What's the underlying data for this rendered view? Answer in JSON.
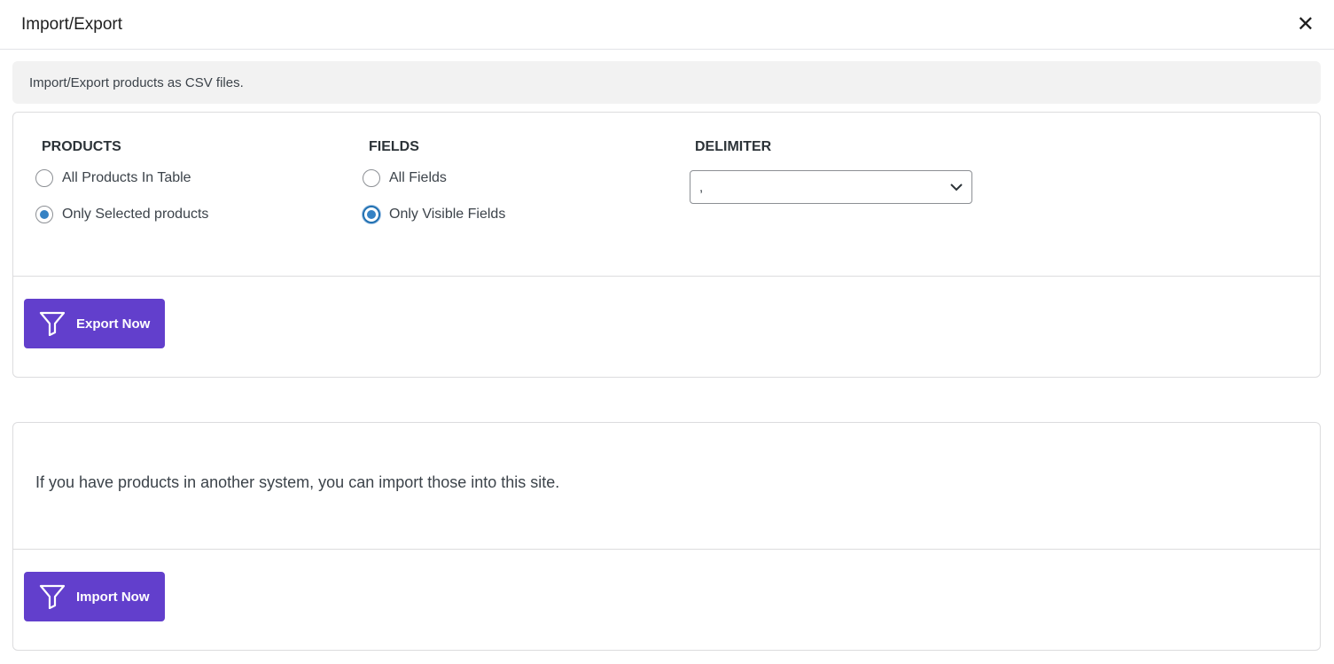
{
  "dialog": {
    "title": "Import/Export",
    "close_icon": "close-icon"
  },
  "notice": "Import/Export products as CSV files.",
  "export": {
    "products": {
      "heading": "PRODUCTS",
      "options": [
        {
          "label": "All Products In Table",
          "selected": false
        },
        {
          "label": "Only Selected products",
          "selected": true
        }
      ]
    },
    "fields": {
      "heading": "FIELDS",
      "options": [
        {
          "label": "All Fields",
          "selected": false
        },
        {
          "label": "Only Visible Fields",
          "selected": true
        }
      ]
    },
    "delimiter": {
      "heading": "DELIMITER",
      "value": ","
    },
    "button": "Export Now"
  },
  "import": {
    "text": "If you have products in another system, you can import those into this site.",
    "button": "Import Now"
  },
  "colors": {
    "accent": "#623fcc",
    "radio": "#3582c4"
  }
}
